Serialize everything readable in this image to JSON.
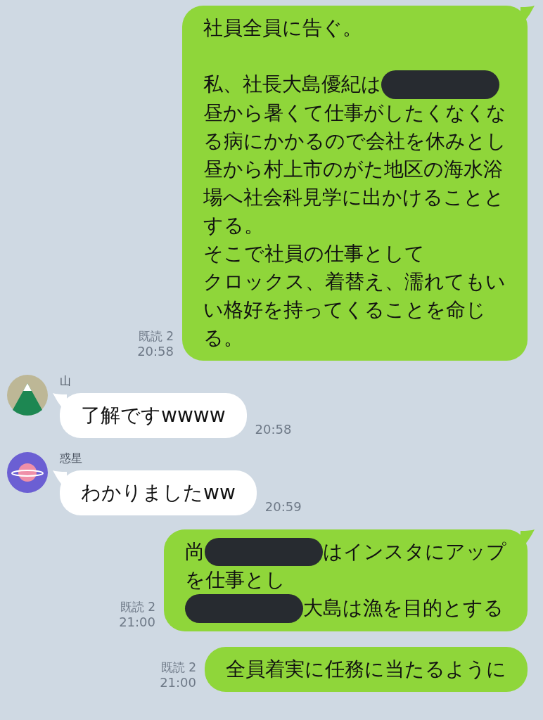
{
  "messages": [
    {
      "kind": "outgoing",
      "tail": true,
      "read": "既読 2",
      "time": "20:58",
      "lines": [
        [
          {
            "kind": "text",
            "text": "社員全員に告ぐ。"
          }
        ],
        [
          {
            "kind": "blank"
          }
        ],
        [
          {
            "kind": "text",
            "text": "私、社長大島優紀は"
          },
          {
            "kind": "redaction"
          }
        ],
        [
          {
            "kind": "text",
            "text": "昼から暑くて仕事がしたくなくな"
          }
        ],
        [
          {
            "kind": "text",
            "text": "る病にかかるので会社を休みとし"
          }
        ],
        [
          {
            "kind": "text",
            "text": "昼から村上市のがた地区の海水浴"
          }
        ],
        [
          {
            "kind": "text",
            "text": "場へ社会科見学に出かけることと"
          }
        ],
        [
          {
            "kind": "text",
            "text": "する。"
          }
        ],
        [
          {
            "kind": "text",
            "text": "そこで社員の仕事として"
          }
        ],
        [
          {
            "kind": "text",
            "text": "クロックス、着替え、濡れてもい"
          }
        ],
        [
          {
            "kind": "text",
            "text": "い格好を持ってくることを命じ"
          }
        ],
        [
          {
            "kind": "text",
            "text": "る。"
          }
        ]
      ]
    },
    {
      "kind": "incoming",
      "tail": true,
      "sender": "山",
      "avatar": {
        "kind": "mountain"
      },
      "time": "20:58",
      "lines": [
        [
          {
            "kind": "text",
            "text": "了解ですwwww"
          }
        ]
      ]
    },
    {
      "kind": "incoming",
      "tail": true,
      "sender": "惑星",
      "avatar": {
        "kind": "planet"
      },
      "time": "20:59",
      "lines": [
        [
          {
            "kind": "text",
            "text": "わかりましたww"
          }
        ]
      ]
    },
    {
      "kind": "outgoing",
      "tail": true,
      "read": "既読 2",
      "time": "21:00",
      "lines": [
        [
          {
            "kind": "text",
            "text": "尚"
          },
          {
            "kind": "redaction"
          },
          {
            "kind": "text",
            "text": "はインスタにアップ"
          }
        ],
        [
          {
            "kind": "text",
            "text": "を仕事とし"
          }
        ],
        [
          {
            "kind": "redaction"
          },
          {
            "kind": "text",
            "text": "大島は漁を目的とする"
          }
        ]
      ]
    },
    {
      "kind": "outgoing",
      "tail": false,
      "read": "既読 2",
      "time": "21:00",
      "lines": [
        [
          {
            "kind": "text",
            "text": "全員着実に任務に当たるように"
          }
        ]
      ]
    }
  ]
}
